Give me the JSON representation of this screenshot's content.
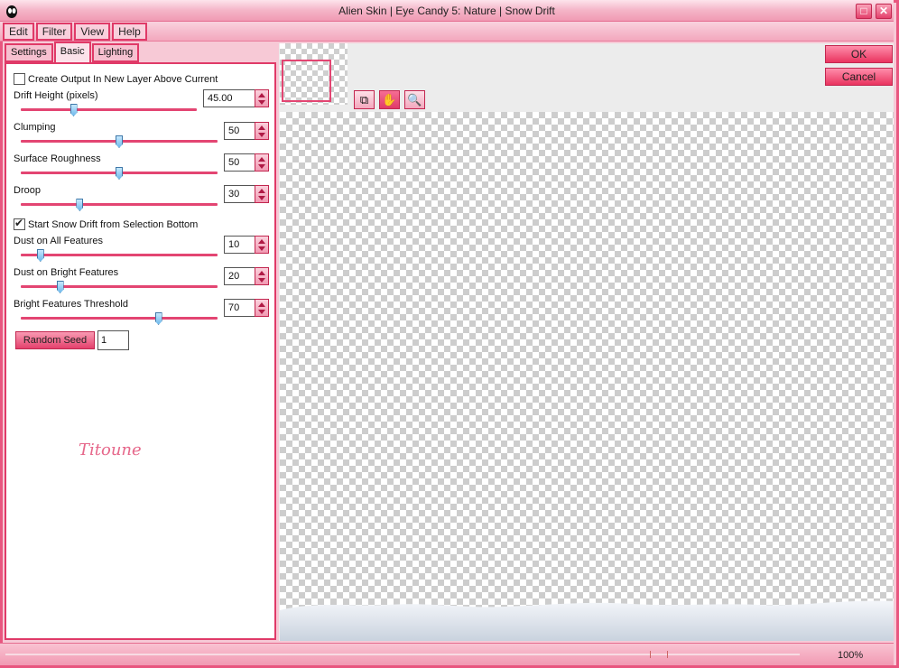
{
  "window": {
    "title": "Alien Skin | Eye Candy 5: Nature | Snow Drift",
    "maximize_glyph": "□",
    "close_glyph": "✕"
  },
  "menu": {
    "edit": "Edit",
    "filter": "Filter",
    "view": "View",
    "help": "Help"
  },
  "tabs": [
    "Settings",
    "Basic",
    "Lighting"
  ],
  "active_tab": "Basic",
  "controls": {
    "create_output": {
      "label": "Create Output In New Layer Above Current",
      "checked": false
    },
    "drift_height": {
      "label": "Drift Height (pixels)",
      "value": "45.00",
      "level": 0.3
    },
    "clumping": {
      "label": "Clumping",
      "value": "50",
      "level": 0.5
    },
    "surface_roughness": {
      "label": "Surface Roughness",
      "value": "50",
      "level": 0.5
    },
    "droop": {
      "label": "Droop",
      "value": "30",
      "level": 0.3
    },
    "start_from_bottom": {
      "label": "Start Snow Drift from Selection Bottom",
      "checked": true
    },
    "dust_all": {
      "label": "Dust on All Features",
      "value": "10",
      "level": 0.1
    },
    "dust_bright": {
      "label": "Dust on Bright Features",
      "value": "20",
      "level": 0.2
    },
    "bright_threshold": {
      "label": "Bright Features Threshold",
      "value": "70",
      "level": 0.7
    },
    "random_seed": {
      "label": "Random Seed",
      "value": "1"
    }
  },
  "signature": "Titoune",
  "buttons": {
    "ok": "OK",
    "cancel": "Cancel"
  },
  "tools": [
    {
      "name": "compare-icon",
      "glyph": "⧉"
    },
    {
      "name": "hand-icon",
      "glyph": "✋"
    },
    {
      "name": "zoom-icon",
      "glyph": "🔍"
    }
  ],
  "status": {
    "zoom": "100%"
  },
  "colors": {
    "accent": "#e03a68",
    "frame": "#f7c9d6",
    "slider_thumb": "#6fb9ea"
  }
}
